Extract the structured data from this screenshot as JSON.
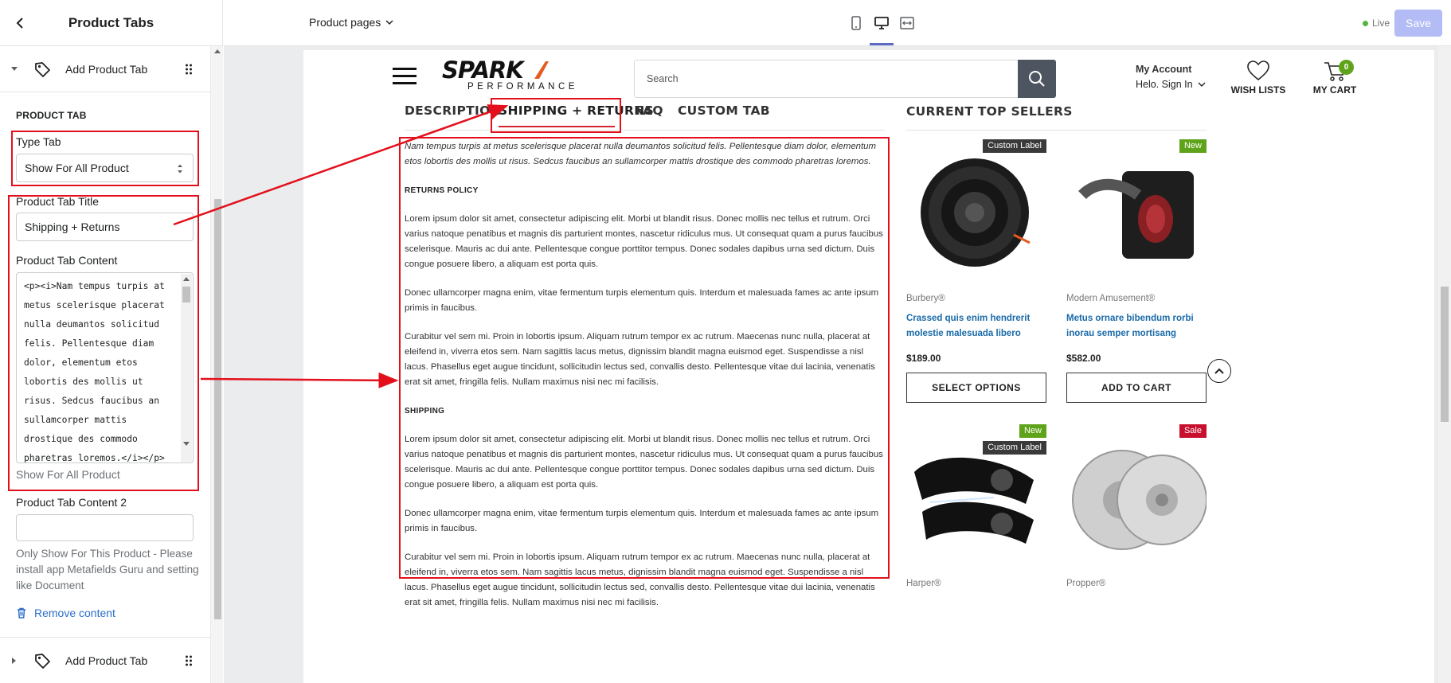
{
  "sidebar": {
    "title": "Product Tabs",
    "block_1_label": "Add Product Tab",
    "section_title": "PRODUCT TAB",
    "type_tab_label": "Type Tab",
    "type_tab_value": "Show For All Product",
    "tab_title_label": "Product Tab Title",
    "tab_title_value": "Shipping + Returns",
    "tab_content_label": "Product Tab Content",
    "tab_content_value": "<p><i>Nam tempus turpis at\nmetus scelerisque placerat\nnulla deumantos solicitud\nfelis. Pellentesque diam\ndolor, elementum etos\nlobortis des mollis ut\nrisus. Sedcus faucibus an\nsullamcorper mattis\ndrostique des commodo\npharetras loremos.</i></p>",
    "show_for_all_hint": "Show For All Product",
    "tab_content_2_label": "Product Tab Content 2",
    "tab_content_2_value": "",
    "help_text": "Only Show For This Product - Please install app Metafields Guru and setting like Document",
    "remove_label": "Remove content",
    "block_2_label": "Add Product Tab"
  },
  "topbar": {
    "page_picker": "Product pages",
    "live_label": "Live",
    "save_label": "Save",
    "active_view": "desktop"
  },
  "store": {
    "logo_word": "SPARK",
    "logo_sub": "PERFORMANCE",
    "search_placeholder": "Search",
    "account_title": "My Account",
    "account_sub": "Helo. Sign In",
    "wish_label": "WISH LISTS",
    "cart_label": "MY CART",
    "cart_count": "0"
  },
  "tabs": [
    "DESCRIPTION",
    "SHIPPING + RETURNS",
    "FAQ",
    "CUSTOM TAB"
  ],
  "tab_content": {
    "intro": "Nam tempus turpis at metus scelerisque placerat nulla deumantos solicitud felis. Pellentesque diam dolor, elementum etos lobortis des mollis ut risus. Sedcus faucibus an sullamcorper mattis drostique des commodo pharetras loremos.",
    "returns_heading": "RETURNS POLICY",
    "p1": "Lorem ipsum dolor sit amet, consectetur adipiscing elit. Morbi ut blandit risus. Donec mollis nec tellus et rutrum. Orci varius natoque penatibus et magnis dis parturient montes, nascetur ridiculus mus. Ut consequat quam a purus faucibus scelerisque. Mauris ac dui ante. Pellentesque congue porttitor tempus. Donec sodales dapibus urna sed dictum. Duis congue posuere libero, a aliquam est porta quis.",
    "p2": "Donec ullamcorper magna enim, vitae fermentum turpis elementum quis. Interdum et malesuada fames ac ante ipsum primis in faucibus.",
    "p3": "Curabitur vel sem mi. Proin in lobortis ipsum. Aliquam rutrum tempor ex ac rutrum. Maecenas nunc nulla, placerat at eleifend in, viverra etos sem. Nam sagittis lacus metus, dignissim blandit magna euismod eget. Suspendisse a nisl lacus. Phasellus eget augue tincidunt, sollicitudin lectus sed, convallis desto. Pellentesque vitae dui lacinia, venenatis erat sit amet, fringilla felis. Nullam maximus nisi nec mi facilisis.",
    "shipping_heading": "SHIPPING",
    "p4": "Lorem ipsum dolor sit amet, consectetur adipiscing elit. Morbi ut blandit risus. Donec mollis nec tellus et rutrum. Orci varius natoque penatibus et magnis dis parturient montes, nascetur ridiculus mus. Ut consequat quam a purus faucibus scelerisque. Mauris ac dui ante. Pellentesque congue porttitor tempus. Donec sodales dapibus urna sed dictum. Duis congue posuere libero, a aliquam est porta quis.",
    "p5": "Donec ullamcorper magna enim, vitae fermentum turpis elementum quis. Interdum et malesuada fames ac ante ipsum primis in faucibus.",
    "p6": "Curabitur vel sem mi. Proin in lobortis ipsum. Aliquam rutrum tempor ex ac rutrum. Maecenas nunc nulla, placerat at eleifend in, viverra etos sem. Nam sagittis lacus metus, dignissim blandit magna euismod eget. Suspendisse a nisl lacus. Phasellus eget augue tincidunt, sollicitudin lectus sed, convallis desto. Pellentesque vitae dui lacinia, venenatis erat sit amet, fringilla felis. Nullam maximus nisi nec mi facilisis."
  },
  "sellers": {
    "title": "CURRENT TOP SELLERS",
    "products": [
      {
        "badge": "Custom Label",
        "vendor": "Burbery®",
        "title": "Crassed quis enim hendrerit molestie malesuada libero",
        "price": "$189.00",
        "button": "SELECT OPTIONS"
      },
      {
        "badge": "New",
        "vendor": "Modern Amusement®",
        "title": "Metus ornare bibendum rorbi inorau semper mortisang",
        "price": "$582.00",
        "button": "ADD TO CART"
      },
      {
        "badge": "New",
        "badge2": "Custom Label",
        "vendor": "Harper®"
      },
      {
        "badge": "Sale",
        "vendor": "Propper®"
      }
    ]
  },
  "colors": {
    "annotation_red": "#e3101c",
    "accent_blue": "#5c6ac4",
    "save_disabled": "#b3bcf5",
    "badge_new": "#5fa31b",
    "badge_custom": "#3a3a3a",
    "badge_sale": "#c8102e",
    "product_link": "#1a6aa8"
  }
}
